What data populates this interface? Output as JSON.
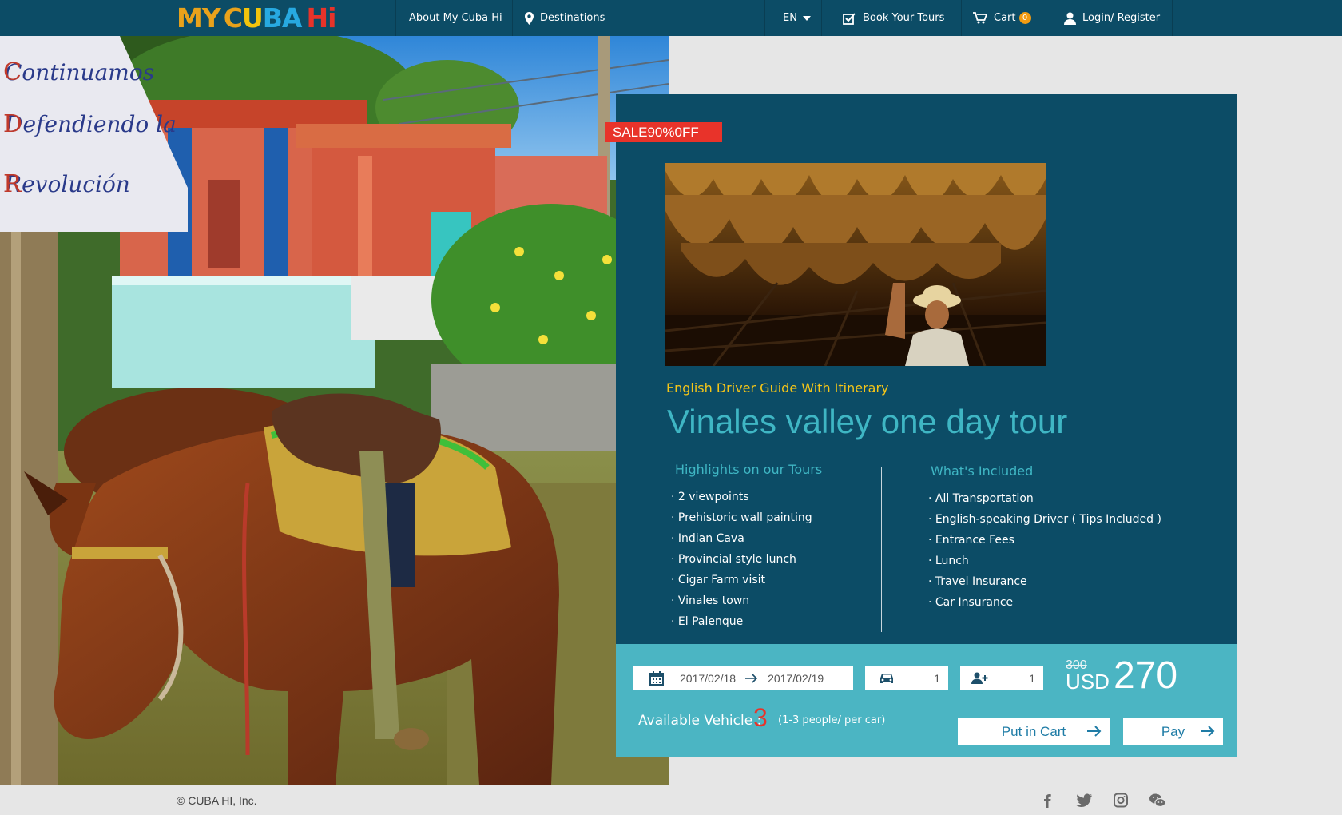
{
  "brand": {
    "logo_parts": [
      {
        "text": "MY",
        "color": "#e8a21b"
      },
      {
        "text": "C",
        "color": "#e8a21b"
      },
      {
        "text": "U",
        "color": "#f2c40c"
      },
      {
        "text": "B",
        "color": "#27a9e1"
      },
      {
        "text": "A",
        "color": "#27a9e1"
      },
      {
        "text": "Hi",
        "color": "#e8332a"
      }
    ]
  },
  "nav": {
    "about": "About My Cuba Hi",
    "destinations": "Destinations",
    "language": "EN",
    "book": "Book Your Tours",
    "cart": "Cart",
    "cart_count": "0",
    "login": "Login/ Register"
  },
  "tour": {
    "sale_badge": "SALE90%0FF",
    "subtitle": "English Driver Guide With Itinerary",
    "title": "Vinales valley one day tour",
    "highlights_heading": "Highlights on our Tours",
    "highlights": [
      "· 2 viewpoints",
      "· Prehistoric wall painting",
      "· Indian Cava",
      "· Provincial style lunch",
      "· Cigar Farm visit",
      "· Vinales town",
      "· El Palenque"
    ],
    "included_heading": "What's Included",
    "included": [
      "· All Transportation",
      "· English-speaking Driver ( Tips Included )",
      "· Entrance Fees",
      "· Lunch",
      "· Travel  Insurance",
      "· Car Insurance"
    ]
  },
  "booking": {
    "start_date": "2017/02/18",
    "end_date": "2017/02/19",
    "vehicles": "1",
    "people": "1",
    "old_price": "300",
    "currency": "USD",
    "price": "270",
    "available_label": "Available Vehicle :",
    "available_count": "3",
    "available_note": "(1-3 people/ per car)",
    "cart_button": "Put in Cart",
    "pay_button": "Pay"
  },
  "footer": {
    "copyright": "© CUBA HI, Inc."
  },
  "colors": {
    "nav_bg": "#0c4c66",
    "card_bg": "#0c4c66",
    "booking_bg": "#4bb5c3",
    "accent_teal": "#3fb6c4",
    "accent_yellow": "#f5c518",
    "sale_red": "#e8332a"
  }
}
